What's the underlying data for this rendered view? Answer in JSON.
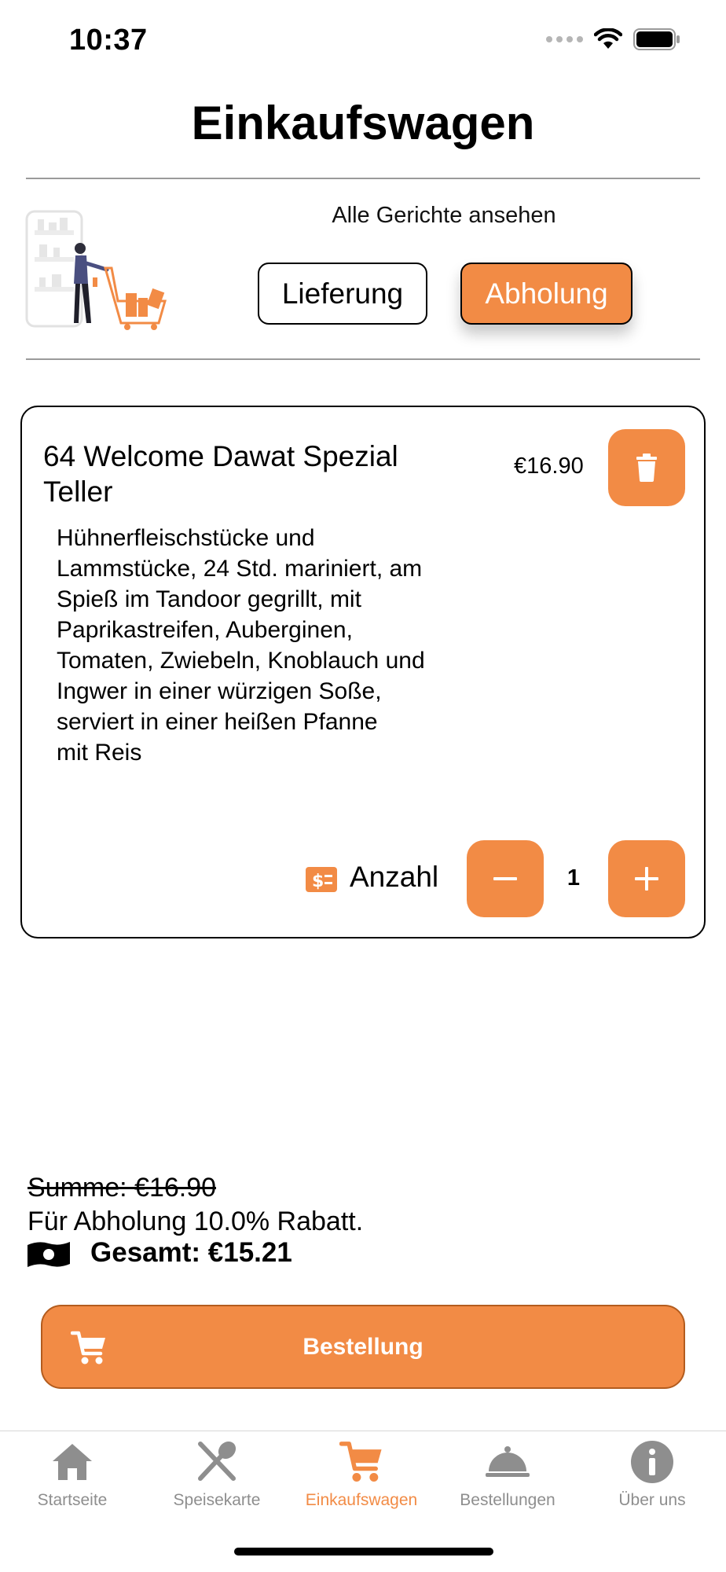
{
  "status_bar": {
    "time": "10:37"
  },
  "header": {
    "title": "Einkaufswagen",
    "view_all_label": "Alle Gerichte ansehen",
    "delivery_label": "Lieferung",
    "pickup_label": "Abholung",
    "selected_mode": "Abholung"
  },
  "cart": {
    "items": [
      {
        "name": "64 Welcome Dawat Spezial Teller",
        "price": "€16.90",
        "description": "Hühnerfleischstücke und\nLammstücke, 24 Std. mariniert, am\nSpieß im Tandoor gegrillt, mit\nPaprikastreifen, Auberginen,\nTomaten, Zwiebeln, Knoblauch und\nIngwer in einer würzigen Soße,\nserviert in einer heißen Pfanne\nmit Reis",
        "quantity_label": "Anzahl",
        "quantity": "1"
      }
    ]
  },
  "totals": {
    "sum_label": "Summe: €16.90",
    "discount_label": "Für Abholung 10.0% Rabatt.",
    "total_label": "Gesamt: €15.21"
  },
  "order_button": {
    "label": "Bestellung"
  },
  "tab_bar": {
    "tabs": [
      {
        "label": "Startseite",
        "icon": "home-icon"
      },
      {
        "label": "Speisekarte",
        "icon": "cutlery-icon"
      },
      {
        "label": "Einkaufswagen",
        "icon": "cart-icon",
        "active": true
      },
      {
        "label": "Bestellungen",
        "icon": "cloche-icon"
      },
      {
        "label": "Über uns",
        "icon": "info-icon"
      }
    ]
  },
  "colors": {
    "accent": "#f28b45",
    "inactive_tab": "#8e8e8e"
  }
}
